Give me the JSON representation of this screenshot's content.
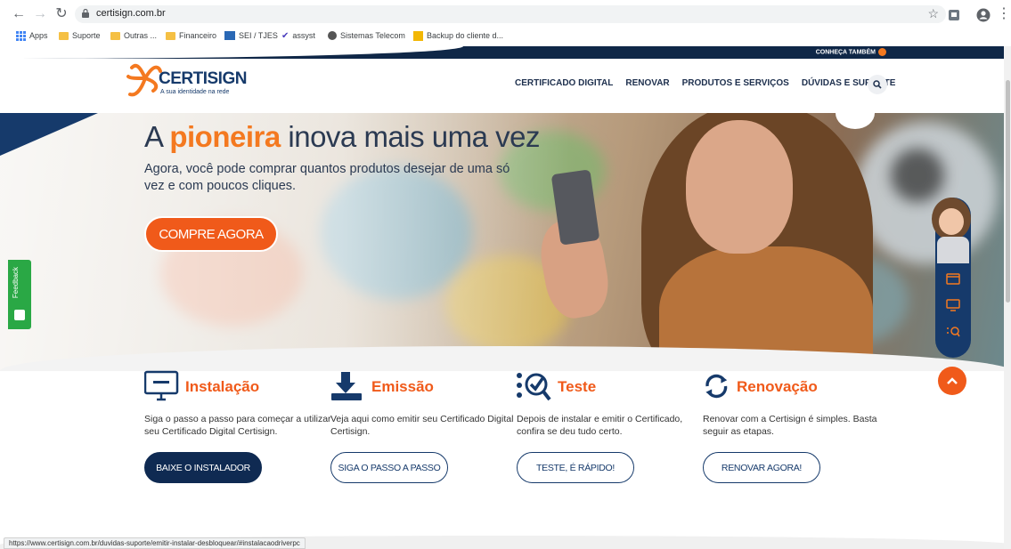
{
  "browser": {
    "url": "certisign.com.br",
    "bookmarks": [
      "Apps",
      "Suporte",
      "Outras ...",
      "Financeiro",
      "SEI / TJES",
      "assyst",
      "Sistemas Telecom",
      "Backup do cliente d..."
    ],
    "status_url": "https://www.certisign.com.br/duvidas-suporte/emitir-instalar-desbloquear/#instalacaodriverpc"
  },
  "topstrip": {
    "label": "CONHEÇA TAMBÉM"
  },
  "header": {
    "logo_text": "CERTISIGN",
    "logo_tagline": "A sua identidade na rede",
    "menu": [
      "CERTIFICADO DIGITAL",
      "RENOVAR",
      "PRODUTOS E SERVIÇOS",
      "DÚVIDAS E SUPORTE"
    ]
  },
  "hero": {
    "headline_pre": "A ",
    "headline_highlight": "pioneira",
    "headline_post": " inova mais uma vez",
    "subline": "Agora, você pode comprar quantos produtos desejar de uma só vez e com poucos cliques.",
    "cta": "COMPRE AGORA"
  },
  "feedback": {
    "label": "Feedback"
  },
  "features": [
    {
      "title": "Instalação",
      "icon": "monitor-icon",
      "desc": "Siga o passo a passo para começar a utilizar seu Certificado Digital Certisign.",
      "button": "BAIXE O INSTALADOR"
    },
    {
      "title": "Emissão",
      "icon": "download-icon",
      "desc": "Veja aqui como emitir seu Certificado Digital Certisign.",
      "button": "SIGA O PASSO A PASSO"
    },
    {
      "title": "Teste",
      "icon": "checklist-search-icon",
      "desc": "Depois de instalar e emitir o Certificado, confira se deu tudo certo.",
      "button": "TESTE, É RÁPIDO!"
    },
    {
      "title": "Renovação",
      "icon": "refresh-icon",
      "desc": "Renovar com a Certisign é simples. Basta seguir as etapas.",
      "button": "RENOVAR AGORA!"
    }
  ],
  "colors": {
    "accent": "#f05a1a",
    "navy": "#163a6b"
  }
}
